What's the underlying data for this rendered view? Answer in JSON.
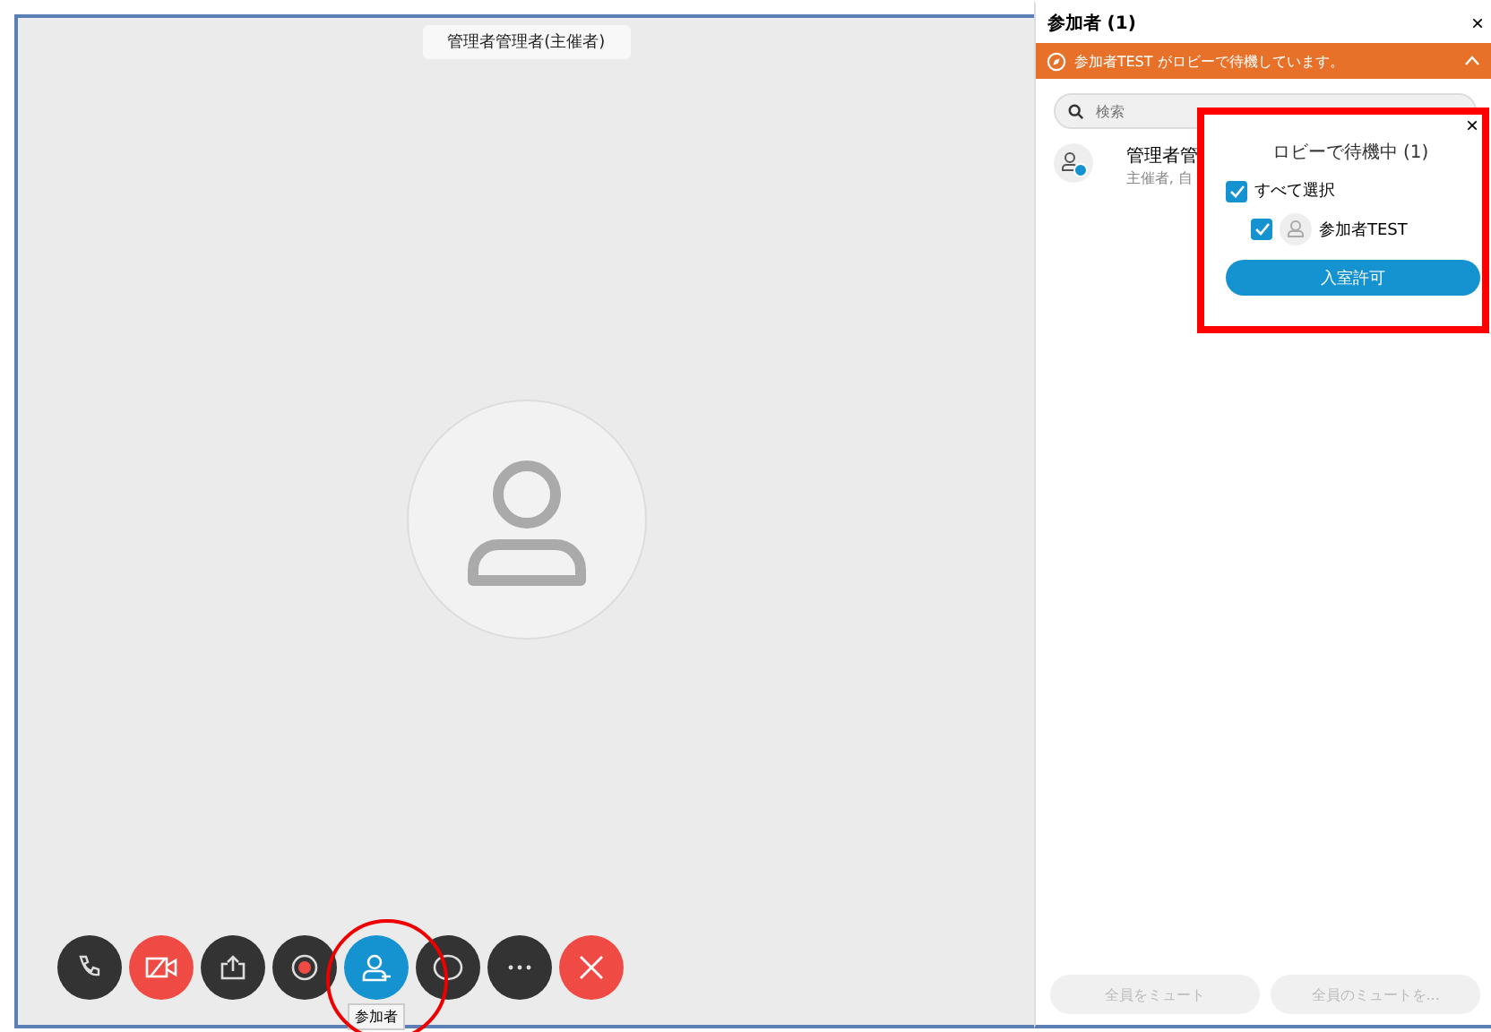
{
  "stage": {
    "name_badge": "管理者管理者(主催者)"
  },
  "controls": [
    {
      "kind": "phone",
      "selected": false
    },
    {
      "kind": "video",
      "selected": false,
      "muted": true
    },
    {
      "kind": "share",
      "selected": false
    },
    {
      "kind": "record",
      "selected": false
    },
    {
      "kind": "participants",
      "selected": true,
      "tooltip": "参加者"
    },
    {
      "kind": "chat",
      "selected": false
    },
    {
      "kind": "more",
      "selected": false
    },
    {
      "kind": "leave",
      "selected": false
    }
  ],
  "panel": {
    "title": "参加者 (1)",
    "close": "×",
    "banner": "参加者TEST がロビーで待機しています。",
    "search": {
      "placeholder": "検索"
    },
    "participants": [
      {
        "name": "管理者管",
        "role": "主催者, 自"
      }
    ],
    "buttons": [
      {
        "label": "全員をミュート",
        "disabled": true
      },
      {
        "label": "全員のミュートを...",
        "disabled": true
      }
    ]
  },
  "lobby_popup": {
    "close": "×",
    "title": "ロビーで待機中 (1)",
    "select_all": {
      "label": "すべて選択",
      "checked": true
    },
    "waiting": [
      {
        "name": "参加者TEST",
        "checked": true
      }
    ],
    "admit_button": "入室許可"
  }
}
